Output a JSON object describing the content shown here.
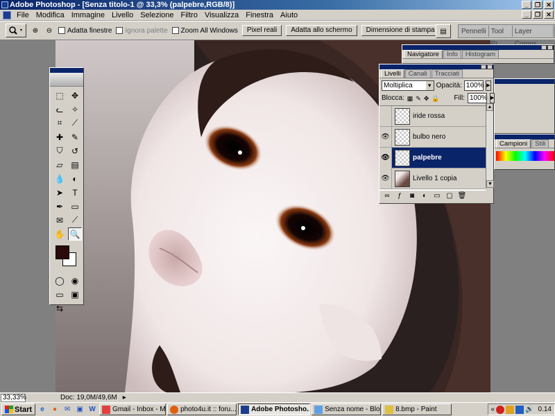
{
  "app": {
    "title": "Adobe Photoshop - [Senza titolo-1 @ 33,3% (palpebre,RGB/8)]",
    "window_buttons": [
      "_",
      "❐",
      "✕"
    ]
  },
  "menu": [
    "File",
    "Modifica",
    "Immagine",
    "Livello",
    "Selezione",
    "Filtro",
    "Visualizza",
    "Finestra",
    "Aiuto"
  ],
  "options": {
    "resize_windows": "Adatta finestre",
    "ignore_palettes": "Ignora palette",
    "zoom_all": "Zoom All Windows",
    "actual_pixels": "Pixel reali",
    "fit_screen": "Adatta allo schermo",
    "print_size": "Dimensione di stampa"
  },
  "palette_well": [
    "Pennelli",
    "Tool Pr",
    "Layer Comps"
  ],
  "navigator": {
    "tabs": [
      "Navigatore",
      "Info",
      "Histogram"
    ]
  },
  "layers_panel": {
    "tabs": [
      "Livelli",
      "Canali",
      "Tracciati"
    ],
    "blend_mode": "Moltiplica",
    "opacity_label": "Opacità:",
    "opacity": "100%",
    "lock_label": "Blocca:",
    "fill_label": "Fill:",
    "fill": "100%",
    "layers": [
      {
        "name": "iride rossa",
        "visible": false
      },
      {
        "name": "bulbo nero",
        "visible": true
      },
      {
        "name": "palpebre",
        "visible": true,
        "active": true
      },
      {
        "name": "Livello 1 copia",
        "visible": true
      }
    ]
  },
  "swatches_panel": {
    "tabs": [
      "Campioni",
      "Stili"
    ]
  },
  "status": {
    "zoom": "33,33%",
    "doc": "Doc: 19,0M/49,6M"
  },
  "taskbar": {
    "start": "Start",
    "tasks": [
      {
        "label": "Gmail - Inbox - Mo...",
        "active": false
      },
      {
        "label": "photo4u.it :: foru...",
        "active": false
      },
      {
        "label": "Adobe Photosho...",
        "active": true
      },
      {
        "label": "Senza nome - Bloc...",
        "active": false
      },
      {
        "label": "8.bmp - Paint",
        "active": false
      }
    ],
    "clock": "0.14"
  },
  "colors": {
    "foreground": "#2a0a0a",
    "background": "#ffffff",
    "title_bar": "#0a246a"
  }
}
